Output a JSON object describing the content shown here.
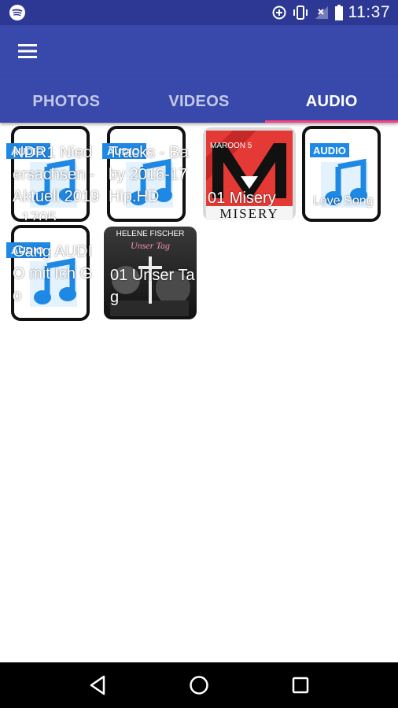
{
  "status_bar": {
    "time": "11:37",
    "icons": [
      "spotify-icon",
      "data-saver-icon",
      "vibrate-icon",
      "no-signal-icon",
      "battery-icon"
    ]
  },
  "toolbar": {
    "menu_icon": "menu-icon"
  },
  "tabs": [
    {
      "label": "PHOTOS",
      "active": false
    },
    {
      "label": "VIDEOS",
      "active": false
    },
    {
      "label": "AUDIO",
      "active": true
    }
  ],
  "colors": {
    "primary": "#3949ab",
    "primary_dark": "#2c3893",
    "accent": "#ff4081",
    "audio_blue": "#1e88e5"
  },
  "audio_items": [
    {
      "title": "NDR1 Niedersachsen - Aktuell 2019_1705...",
      "thumbnail": "audio-file-icon",
      "badge": "AUDIO"
    },
    {
      "title": "Tracks - Baby 2016-17 Hip.HD",
      "thumbnail": "audio-file-icon",
      "badge": "AUDIO"
    },
    {
      "title": "01 Misery",
      "thumbnail": "album-art-misery",
      "art_text": "MISERY",
      "art_top_text": "MAROON 5"
    },
    {
      "title": "Love Song",
      "thumbnail": "audio-file-icon",
      "badge": "AUDIO"
    },
    {
      "title": "Gang AUDIO mit Ich Go",
      "thumbnail": "audio-file-icon",
      "badge": "AUDIO"
    },
    {
      "title": "01 Unser Tag",
      "thumbnail": "album-art-unser-tag",
      "art_text": "HELENE FISCHER",
      "art_sub": "Unser Tag"
    }
  ],
  "nav_bar": {
    "buttons": [
      "back-icon",
      "home-icon",
      "recents-icon"
    ]
  }
}
